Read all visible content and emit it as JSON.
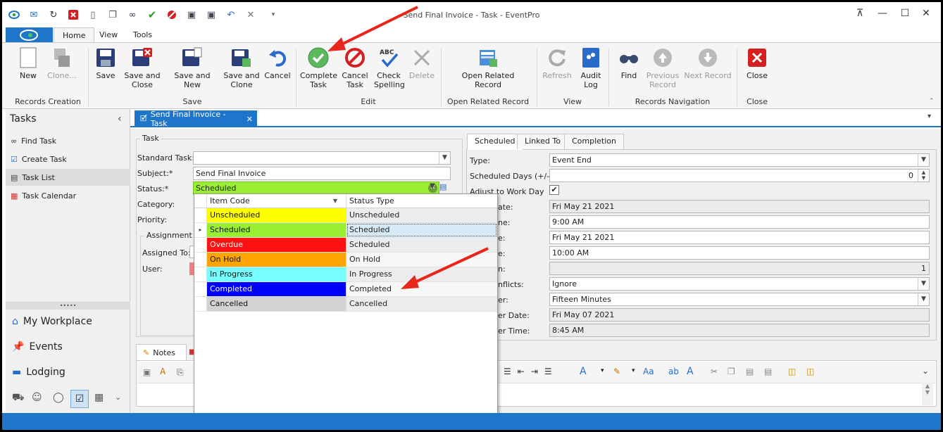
{
  "window": {
    "title": "Send Final Invoice - Task - EventPro"
  },
  "menu": {
    "tabs": [
      "Home",
      "View",
      "Tools"
    ]
  },
  "ribbon": {
    "buttons": {
      "new": "New",
      "clone": "Clone...",
      "save": "Save",
      "save_close": [
        "Save and",
        "Close"
      ],
      "save_new": "Save and New",
      "save_clone": [
        "Save and",
        "Clone"
      ],
      "cancel": "Cancel",
      "complete": [
        "Complete",
        "Task"
      ],
      "cancel_task": [
        "Cancel",
        "Task"
      ],
      "check_spelling": [
        "Check",
        "Spelling"
      ],
      "delete": "Delete",
      "open_related": [
        "Open Related",
        "Record"
      ],
      "refresh": "Refresh",
      "audit": [
        "Audit",
        "Log"
      ],
      "find": "Find",
      "prev": [
        "Previous",
        "Record"
      ],
      "next": "Next Record",
      "close": "Close"
    },
    "groups": [
      "Records Creation",
      "Save",
      "Edit",
      "Open Related Record",
      "View",
      "Records Navigation",
      "Close"
    ]
  },
  "nav": {
    "header": "Tasks",
    "items": [
      "Find Task",
      "Create Task",
      "Task List",
      "Task Calendar"
    ],
    "bottom": [
      "My Workplace",
      "Events",
      "Lodging"
    ],
    "grip": "•••••"
  },
  "doc": {
    "tab": "Send Final Invoice - Task"
  },
  "task": {
    "group": "Task",
    "standard_task_label": "Standard Task:",
    "subject_label": "Subject:*",
    "subject": "Send Final Invoice",
    "status_label": "Status:*",
    "status": "Scheduled",
    "category_label": "Category:",
    "priority_label": "Priority:",
    "assignment": "Assignment",
    "assigned_to_label": "Assigned To:",
    "user_label": "User:"
  },
  "notes": {
    "tab": "Notes"
  },
  "right": {
    "tabs": [
      "Scheduled",
      "Linked To",
      "Completion"
    ],
    "type_label": "Type:",
    "type": "Event End",
    "sched_days_label": "Scheduled Days (+/-):",
    "sched_days": "0",
    "adjust_label": "Adjust to Work Day",
    "date_label": "ate:",
    "date": "Fri May 21 2021",
    "time_label": "ne:",
    "time": "9:00 AM",
    "end_date_label": "e:",
    "end_date": "Fri May 21 2021",
    "end_time_label": "e:",
    "end_time": "10:00 AM",
    "duration_label": "n:",
    "duration": "1",
    "conflicts_label": "nflicts:",
    "conflicts": "Ignore",
    "reminder_label": "er:",
    "reminder": "Fifteen Minutes",
    "rem_date_label": "er Date:",
    "rem_date": "Fri May 07 2021",
    "rem_time_label": "er Time:",
    "rem_time": "8:45 AM"
  },
  "status_grid": {
    "columns": [
      "Item Code",
      "Status Type"
    ],
    "rows": [
      {
        "code": "Unscheduled",
        "type": "Unscheduled",
        "color": "#ffff00"
      },
      {
        "code": "Scheduled",
        "type": "Scheduled",
        "color": "#99ee33"
      },
      {
        "code": "Overdue",
        "type": "Scheduled",
        "color": "#ff1111"
      },
      {
        "code": "On Hold",
        "type": "On Hold",
        "color": "#ffa500"
      },
      {
        "code": "In Progress",
        "type": "In Progress",
        "color": "#77ffff"
      },
      {
        "code": "Completed",
        "type": "Completed",
        "color": "#0000ff"
      },
      {
        "code": "Cancelled",
        "type": "Cancelled",
        "color": "#d3d3d3"
      }
    ]
  },
  "colors": {
    "accent": "#1e75c9",
    "status_field": "#99ee33",
    "arrow": "#e8261c"
  }
}
